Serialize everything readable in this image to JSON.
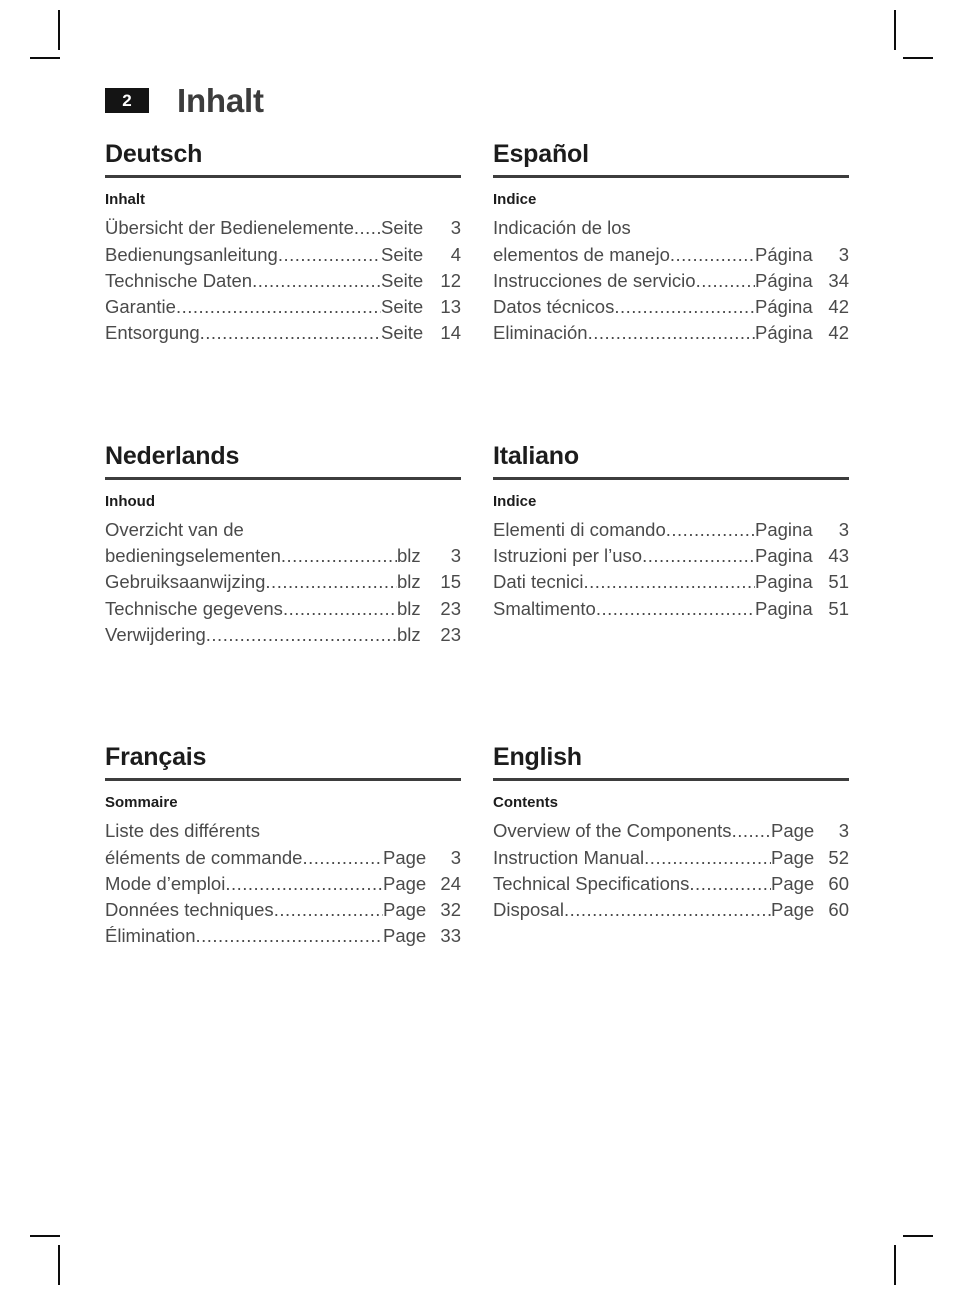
{
  "header": {
    "page_number": "2",
    "title": "Inhalt"
  },
  "sections": [
    {
      "language": "Deutsch",
      "subheading": "Inhalt",
      "page_label": "Seite",
      "label_width_class": "pw-seite",
      "entries": [
        {
          "lead": "",
          "title": "Übersicht der Bedienelemente",
          "leader": "......",
          "page_label": "Seite",
          "page": "3"
        },
        {
          "lead": "",
          "title": "Bedienungsanleitung",
          "leader": "........................",
          "page_label": "Seite",
          "page": "4"
        },
        {
          "lead": "",
          "title": "Technische Daten",
          "leader": ".............................",
          "page_label": "Seite",
          "page": "12"
        },
        {
          "lead": "",
          "title": "Garantie",
          "leader": ".................................................",
          "page_label": "Seite",
          "page": "13"
        },
        {
          "lead": "",
          "title": "Entsorgung",
          "leader": "..........................................",
          "page_label": "Seite",
          "page": "14"
        }
      ]
    },
    {
      "language": "Español",
      "subheading": "Indice",
      "page_label": "Página",
      "label_width_class": "pw-pagina",
      "entries": [
        {
          "lead": "Indicación de los",
          "title": "elementos de manejo",
          "leader": "...................",
          "page_label": "Página",
          "page": "3"
        },
        {
          "lead": "",
          "title": "Instrucciones de servicio",
          "leader": "...............",
          "page_label": "Página",
          "page": "34"
        },
        {
          "lead": "",
          "title": "Datos técnicos",
          "leader": "................................",
          "page_label": "Página",
          "page": "42"
        },
        {
          "lead": "",
          "title": "Eliminación",
          "leader": "......................................",
          "page_label": "Página",
          "page": "42"
        }
      ]
    },
    {
      "language": "Nederlands",
      "subheading": "Inhoud",
      "page_label": "blz",
      "label_width_class": "pw-blz",
      "entries": [
        {
          "lead": "Overzicht van de",
          "title": "bedieningselementen",
          "leader": "..........................",
          "page_label": "blz",
          "page": "3"
        },
        {
          "lead": "",
          "title": "Gebruiksaanwijzing",
          "leader": "...............................",
          "page_label": "blz",
          "page": "15"
        },
        {
          "lead": "",
          "title": "Technische gegevens",
          "leader": "...........................",
          "page_label": "blz",
          "page": "23"
        },
        {
          "lead": "",
          "title": "Verwijdering",
          "leader": "..........................................",
          "page_label": "blz",
          "page": "23"
        }
      ]
    },
    {
      "language": "Italiano",
      "subheading": "Indice",
      "page_label": "Pagina",
      "label_width_class": "pw-pagina",
      "entries": [
        {
          "lead": "",
          "title": "Elementi di comando",
          "leader": "...................",
          "page_label": "Pagina",
          "page": "3"
        },
        {
          "lead": "",
          "title": "Istruzioni per l’uso",
          "leader": "...........................",
          "page_label": "Pagina",
          "page": "43"
        },
        {
          "lead": "",
          "title": "Dati tecnici",
          "leader": ".......................................",
          "page_label": "Pagina",
          "page": "51"
        },
        {
          "lead": "",
          "title": "Smaltimento",
          "leader": "....................................",
          "page_label": "Pagina",
          "page": "51"
        }
      ]
    },
    {
      "language": "Français",
      "subheading": "Sommaire",
      "page_label": "Page",
      "label_width_class": "pw-page",
      "entries": [
        {
          "lead": "Liste des différents",
          "title": "éléments de commande",
          "leader": "................",
          "page_label": "Page",
          "page": "3"
        },
        {
          "lead": "",
          "title": "Mode d’emploi",
          "leader": ".................................",
          "page_label": "Page",
          "page": "24"
        },
        {
          "lead": "",
          "title": "Données techniques",
          "leader": ".......................",
          "page_label": "Page",
          "page": "32"
        },
        {
          "lead": "",
          "title": "Élimination",
          "leader": "........................................",
          "page_label": "Page",
          "page": "33"
        }
      ]
    },
    {
      "language": "English",
      "subheading": "Contents",
      "page_label": "Page",
      "label_width_class": "pw-page",
      "entries": [
        {
          "lead": "",
          "title": "Overview of the Components",
          "leader": ".......",
          "page_label": "Page",
          "page": "3"
        },
        {
          "lead": "",
          "title": "Instruction Manual",
          "leader": "............................",
          "page_label": "Page",
          "page": "52"
        },
        {
          "lead": "",
          "title": "Technical Specifications",
          "leader": "..................",
          "page_label": "Page",
          "page": "60"
        },
        {
          "lead": "",
          "title": "Disposal",
          "leader": ".............................................",
          "page_label": "Page",
          "page": "60"
        }
      ]
    }
  ]
}
